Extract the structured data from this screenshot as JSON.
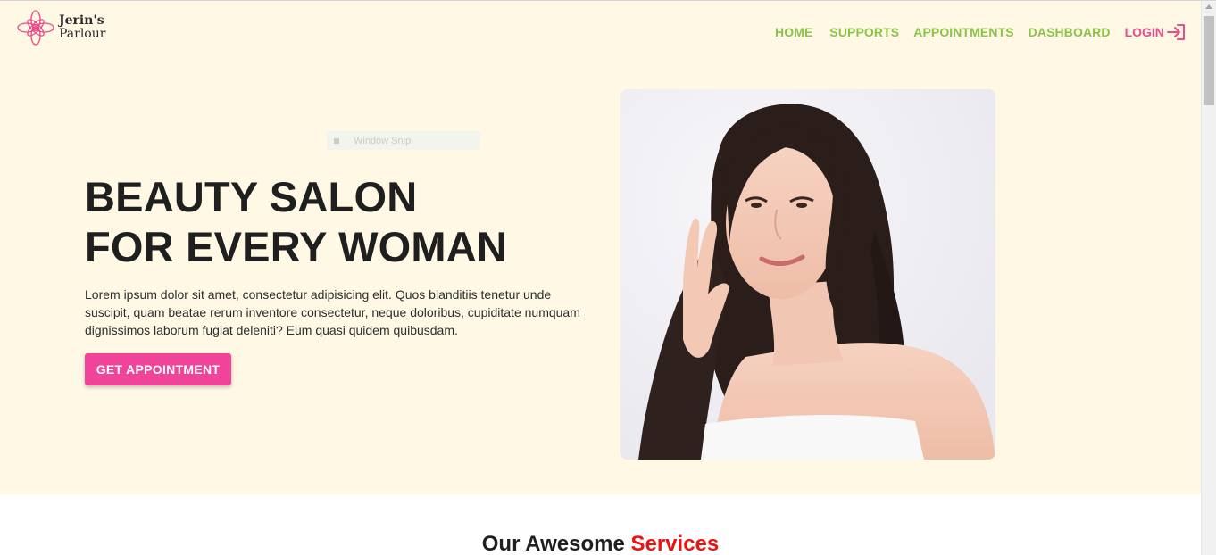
{
  "brand": {
    "line1": "Jerin's",
    "line2": "Parlour",
    "icon": "lotus-flower-icon",
    "color": "#ea4c89"
  },
  "nav": {
    "items": [
      {
        "label": "HOME"
      },
      {
        "label": "SUPPORTS"
      },
      {
        "label": "APPOINTMENTS"
      },
      {
        "label": "DASHBOARD"
      }
    ],
    "login_label": "LOGIN",
    "login_icon": "login-arrow-icon",
    "link_color": "#8bc34a",
    "login_color": "#ea4c89"
  },
  "overlay": {
    "label": "Window Snip"
  },
  "hero": {
    "headline_line1": "BEAUTY SALON",
    "headline_line2": "FOR EVERY WOMAN",
    "description": "Lorem ipsum dolor sit amet, consectetur adipisicing elit. Quos blanditiis tenetur unde suscipit, quam beatae rerum inventore consectetur, neque doloribus, cupiditate numquam dignissimos laborum fugiat deleniti? Eum quasi quidem quibusdam.",
    "cta_label": "GET APPOINTMENT",
    "cta_color": "#f0449a",
    "background": "#fff8e5"
  },
  "services": {
    "title_prefix": "Our Awesome",
    "title_accent": "Services",
    "accent_color": "#ee1111"
  }
}
